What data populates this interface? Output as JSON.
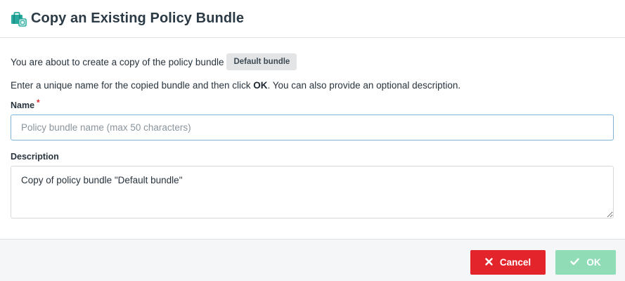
{
  "header": {
    "icon": "briefcase-copy-icon",
    "title": "Copy an Existing Policy Bundle"
  },
  "intro": {
    "text": "You are about to create a copy of the policy bundle",
    "bundle_tag": "Default bundle"
  },
  "instructions": {
    "before_ok": "Enter a unique name for the copied bundle and then click ",
    "ok_word": "OK",
    "after_ok": ". You can also provide an optional description."
  },
  "name_field": {
    "label": "Name",
    "required_marker": "*",
    "value": "",
    "placeholder": "Policy bundle name (max 50 characters)"
  },
  "description_field": {
    "label": "Description",
    "value": "Copy of policy bundle \"Default bundle\""
  },
  "footer": {
    "cancel_label": "Cancel",
    "cancel_icon": "close-icon",
    "ok_label": "OK",
    "ok_icon": "check-icon",
    "ok_enabled": false
  },
  "colors": {
    "accent_teal": "#27a99d",
    "cancel_red": "#e3242b",
    "ok_green_disabled": "#8fdcb7",
    "required_red": "#e1282e",
    "input_focus_border": "#7fb4d8"
  }
}
